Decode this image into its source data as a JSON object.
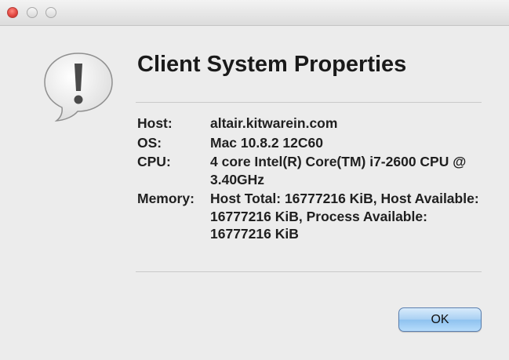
{
  "dialog": {
    "title": "Client System Properties",
    "properties": [
      {
        "label": "Host:",
        "value": "altair.kitwarein.com"
      },
      {
        "label": "OS:",
        "value": "Mac 10.8.2 12C60"
      },
      {
        "label": "CPU:",
        "value": "4 core Intel(R) Core(TM) i7-2600 CPU @ 3.40GHz"
      },
      {
        "label": "Memory:",
        "value": "Host Total: 16777216 KiB, Host Available: 16777216 KiB, Process Available: 16777216 KiB"
      }
    ],
    "ok_label": "OK"
  },
  "window_controls": {
    "close_color": "#e0443e",
    "inactive_color": "#d9d9d9"
  },
  "icons": {
    "alert": "exclamation-speech-bubble"
  }
}
